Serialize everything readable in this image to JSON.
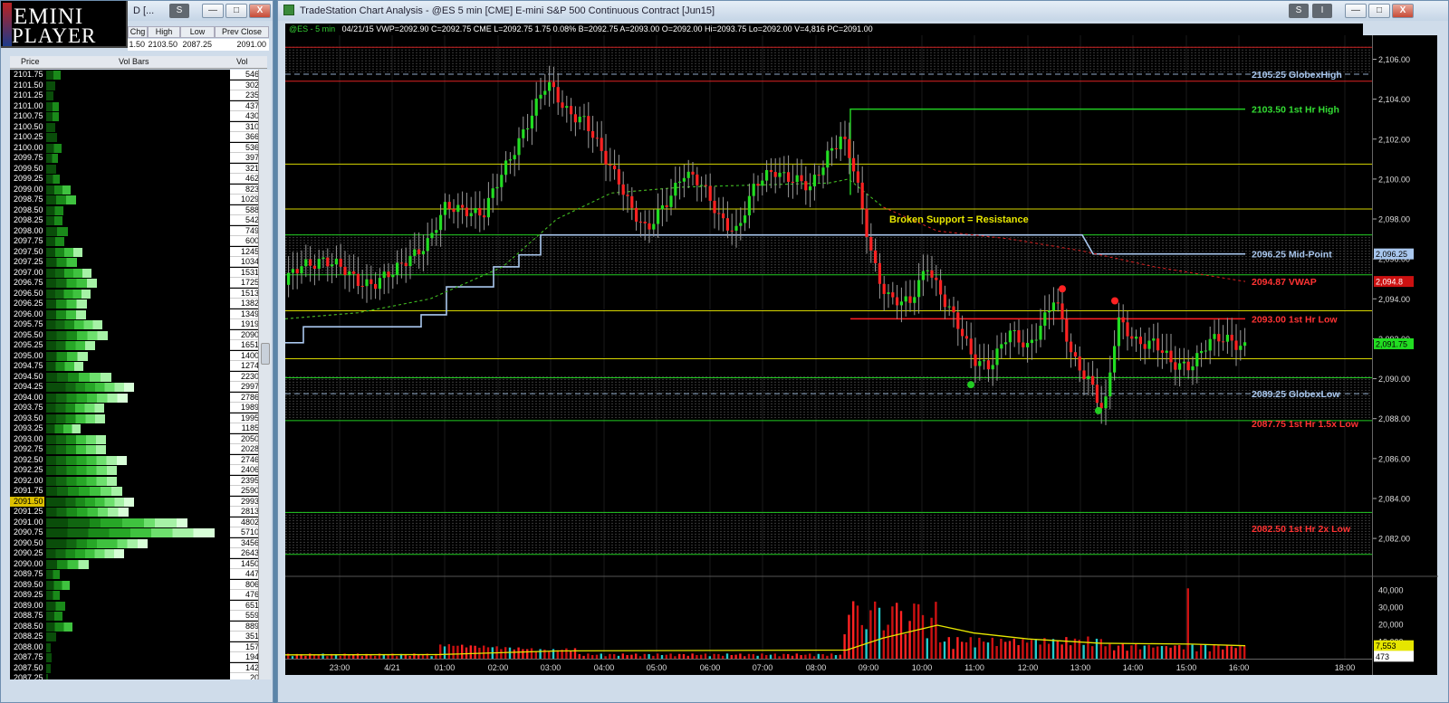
{
  "logo": {
    "line1": "EMINI",
    "line2": "PLAYER"
  },
  "left_window": {
    "title": "D [...",
    "chip": "S",
    "btn_min": "—",
    "btn_max": "□",
    "btn_close": "X",
    "quote_headers": [
      "Chg",
      "High",
      "Low",
      "Prev Close"
    ],
    "quote_values": [
      "1.50",
      "2103.50",
      "2087.25",
      "2091.00"
    ],
    "vp_headers": {
      "price": "Price",
      "bars": "Vol Bars",
      "vol": "Vol"
    },
    "rows": [
      {
        "p": "2101.75",
        "v": "5468",
        "w": 16
      },
      {
        "p": "2101.50",
        "v": "3025",
        "w": 10
      },
      {
        "p": "2101.25",
        "v": "2350",
        "w": 8
      },
      {
        "p": "2101.00",
        "v": "4376",
        "w": 14
      },
      {
        "p": "2100.75",
        "v": "4304",
        "w": 14
      },
      {
        "p": "2100.50",
        "v": "3102",
        "w": 10
      },
      {
        "p": "2100.25",
        "v": "3666",
        "w": 12
      },
      {
        "p": "2100.00",
        "v": "5368",
        "w": 17
      },
      {
        "p": "2099.75",
        "v": "3974",
        "w": 13
      },
      {
        "p": "2099.50",
        "v": "3217",
        "w": 11
      },
      {
        "p": "2099.25",
        "v": "4620",
        "w": 15
      },
      {
        "p": "2099.00",
        "v": "8232",
        "w": 27
      },
      {
        "p": "2098.75",
        "v": "10297",
        "w": 33
      },
      {
        "p": "2098.50",
        "v": "5889",
        "w": 19
      },
      {
        "p": "2098.25",
        "v": "5420",
        "w": 18
      },
      {
        "p": "2098.00",
        "v": "7497",
        "w": 24
      },
      {
        "p": "2097.75",
        "v": "6006",
        "w": 20
      },
      {
        "p": "2097.50",
        "v": "12455",
        "w": 40
      },
      {
        "p": "2097.25",
        "v": "10345",
        "w": 34
      },
      {
        "p": "2097.00",
        "v": "15318",
        "w": 50
      },
      {
        "p": "2096.75",
        "v": "17255",
        "w": 56
      },
      {
        "p": "2096.50",
        "v": "15133",
        "w": 49
      },
      {
        "p": "2096.25",
        "v": "13824",
        "w": 45
      },
      {
        "p": "2096.00",
        "v": "13494",
        "w": 44
      },
      {
        "p": "2095.75",
        "v": "19196",
        "w": 62
      },
      {
        "p": "2095.50",
        "v": "20905",
        "w": 68
      },
      {
        "p": "2095.25",
        "v": "16519",
        "w": 54
      },
      {
        "p": "2095.00",
        "v": "14001",
        "w": 46
      },
      {
        "p": "2094.75",
        "v": "12748",
        "w": 41
      },
      {
        "p": "2094.50",
        "v": "22309",
        "w": 72
      },
      {
        "p": "2094.25",
        "v": "29978",
        "w": 97
      },
      {
        "p": "2094.00",
        "v": "27868",
        "w": 90
      },
      {
        "p": "2093.75",
        "v": "19891",
        "w": 64
      },
      {
        "p": "2093.50",
        "v": "19951",
        "w": 65
      },
      {
        "p": "2093.25",
        "v": "11854",
        "w": 38
      },
      {
        "p": "2093.00",
        "v": "20509",
        "w": 66
      },
      {
        "p": "2092.75",
        "v": "20281",
        "w": 66
      },
      {
        "p": "2092.50",
        "v": "27463",
        "w": 89
      },
      {
        "p": "2092.25",
        "v": "24062",
        "w": 78
      },
      {
        "p": "2092.00",
        "v": "23957",
        "w": 78
      },
      {
        "p": "2091.75",
        "v": "25908",
        "w": 84
      },
      {
        "p": "2091.50",
        "v": "29934",
        "w": 97,
        "sel": true
      },
      {
        "p": "2091.25",
        "v": "28134",
        "w": 91
      },
      {
        "p": "2091.00",
        "v": "48024",
        "w": 156
      },
      {
        "p": "2090.75",
        "v": "57107",
        "w": 186
      },
      {
        "p": "2090.50",
        "v": "34561",
        "w": 112
      },
      {
        "p": "2090.25",
        "v": "26431",
        "w": 86
      },
      {
        "p": "2090.00",
        "v": "14501",
        "w": 47
      },
      {
        "p": "2089.75",
        "v": "4476",
        "w": 15
      },
      {
        "p": "2089.50",
        "v": "8061",
        "w": 26
      },
      {
        "p": "2089.25",
        "v": "4760",
        "w": 15
      },
      {
        "p": "2089.00",
        "v": "6517",
        "w": 21
      },
      {
        "p": "2088.75",
        "v": "5592",
        "w": 18
      },
      {
        "p": "2088.50",
        "v": "8891",
        "w": 29
      },
      {
        "p": "2088.25",
        "v": "3516",
        "w": 11
      },
      {
        "p": "2088.00",
        "v": "1578",
        "w": 5
      },
      {
        "p": "2087.75",
        "v": "1949",
        "w": 6
      },
      {
        "p": "2087.50",
        "v": "1421",
        "w": 5
      },
      {
        "p": "2087.25",
        "v": "207",
        "w": 2
      }
    ]
  },
  "chart_window": {
    "title": "TradeStation Chart Analysis - @ES 5 min [CME] E-mini S&P 500 Continuous Contract [Jun15]",
    "chip1": "S",
    "chip2": "I",
    "btn_min": "—",
    "btn_max": "□",
    "btn_close": "X",
    "symbol": "@ES - 5 min",
    "info": "04/21/15  VWP=2092.90  C=2092.75  CME  L=2092.75  1.75  0.08%  B=2092.75  A=2093.00  O=2092.00  Hi=2093.75  Lo=2092.00  V=4,816  PC=2091.00",
    "price_ticks": [
      "2,106.00",
      "2,104.00",
      "2,102.00",
      "2,100.00",
      "2,098.00",
      "2,096.00",
      "2,094.00",
      "2,092.00",
      "2,090.00",
      "2,088.00",
      "2,086.00",
      "2,084.00",
      "2,082.00"
    ],
    "vol_ticks": [
      "40,000",
      "30,000",
      "20,000",
      "10,000"
    ],
    "price_tags": {
      "midpoint": "2,096.25",
      "vwap": "2,094.8",
      "last": "2,091.75"
    },
    "vol_tags": {
      "a": "7,553",
      "b": "473"
    },
    "time_ticks": [
      "23:00",
      "4/21",
      "01:00",
      "02:00",
      "03:00",
      "04:00",
      "05:00",
      "06:00",
      "07:00",
      "08:00",
      "09:00",
      "10:00",
      "11:00",
      "12:00",
      "13:00",
      "14:00",
      "15:00",
      "16:00",
      "18:00",
      "19:00"
    ],
    "annotation": "Broken Support = Resistance",
    "levels": [
      {
        "label": "2105.25 GlobexHigh",
        "color": "#a9c7ee"
      },
      {
        "label": "2103.50 1st Hr  High",
        "color": "#33dd33"
      },
      {
        "label": "2096.25 Mid-Point",
        "color": "#a9c7ee"
      },
      {
        "label": "2094.87 VWAP",
        "color": "#ff3333"
      },
      {
        "label": "2093.00 1st Hr  Low",
        "color": "#ff3333"
      },
      {
        "label": "2089.25 GlobexLow",
        "color": "#a9c7ee"
      },
      {
        "label": "2087.75 1st Hr  1.5x Low",
        "color": "#ff3333"
      },
      {
        "label": "2082.50 1st Hr  2x Low",
        "color": "#ff3333"
      }
    ]
  }
}
